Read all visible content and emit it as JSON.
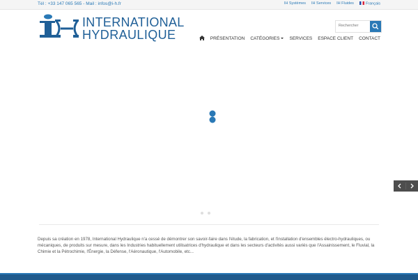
{
  "topbar": {
    "contact_text": "Tél : +33 147 065 565 - Mail : infos@i-h.fr",
    "links": [
      {
        "label": "IH Systèmes"
      },
      {
        "label": "IH Services"
      },
      {
        "label": "IH Fluides"
      },
      {
        "label": "Français"
      }
    ]
  },
  "header": {
    "logo_line1": "INTERNATIONAL",
    "logo_line2": "HYDRAULIQUE",
    "search_placeholder": "Rechercher",
    "nav": [
      {
        "label": "PRÉSENTATION"
      },
      {
        "label": "CATÉGORIES"
      },
      {
        "label": "SERVICES"
      },
      {
        "label": "ESPACE CLIENT"
      },
      {
        "label": "CONTACT"
      }
    ]
  },
  "icons": {
    "home": "home-icon",
    "search": "search-icon",
    "prev": "chevron-left-icon",
    "next": "chevron-right-icon",
    "flag": "french-flag-icon",
    "loader": "loading-spinner-icon"
  },
  "colors": {
    "brand_blue": "#1f5f97",
    "accent_blue": "#2a79b6",
    "footer_blue": "#1f5a8c",
    "arrow_bg": "#4d4d4d"
  },
  "main": {
    "description": "Depuis sa création en 1978, International Hydraulique n'a cessé de démontrer son savoir-faire dans l'étude, la fabrication, et l'installation d'ensembles électro-hydrauliques, ou mécaniques, de produits sur mesure, dans les Industries habituellement utilisatrices d'hydraulique et dans les secteurs d'activités aussi variés que l'Assainissement, le Fluvial, la Chimie et la Pétrochimie, l'Énergie, la Défense, l'Aéronautique, l'Automobile, etc..."
  }
}
